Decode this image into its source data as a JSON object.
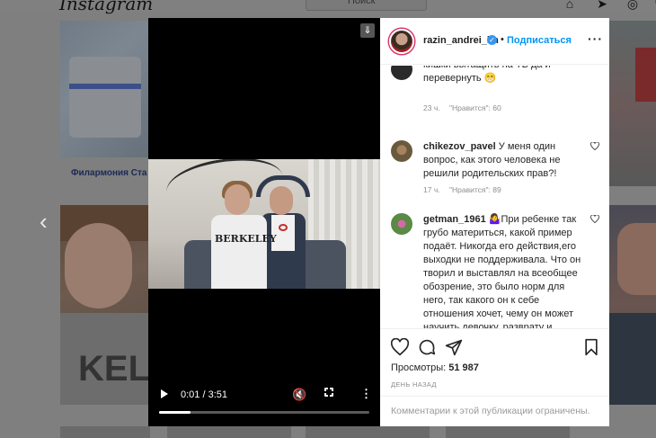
{
  "background": {
    "logo": "Instagram",
    "search_placeholder": "Поиск",
    "tile_caption": "Филармония Ста",
    "tile_shirt_text": "KEL"
  },
  "post": {
    "author": "razin_andrei_lm",
    "separator": "•",
    "follow_label": "Подписаться",
    "video": {
      "time": "0:01 / 3:51",
      "progress": 0.15,
      "shirt_text": "BERKELEY"
    },
    "comments": [
      {
        "user": "",
        "text": "кишки вытащить на ТВ да и перевернуть 😁",
        "age": "23 ч.",
        "likes": "\"Нравится\": 60"
      },
      {
        "user": "chikezov_pavel",
        "text": " У меня один вопрос, как этого человека не решили родительских прав?!",
        "age": "17 ч.",
        "likes": "\"Нравится\": 89"
      },
      {
        "user": "getman_1961",
        "text": " 🤷‍♀️При ребенке так грубо материться, какой пример подаёт. Никогда его действия,его выходки не поддерживала. Что он творил и выставлял на всеобщее обозрение, это было норм для него, так какого он к себе отношения хочет, чему он может научить девочку, разврату и вседозволенности"
      }
    ],
    "views_label": "Просмотры:",
    "views_count": "51 987",
    "date": "ДЕНЬ НАЗАД",
    "comments_limited": "Комментарии к этой публикации ограничены."
  },
  "colors": {
    "accent": "#0095f6",
    "verified": "#3897f0",
    "story_ring": "#d8336f"
  }
}
